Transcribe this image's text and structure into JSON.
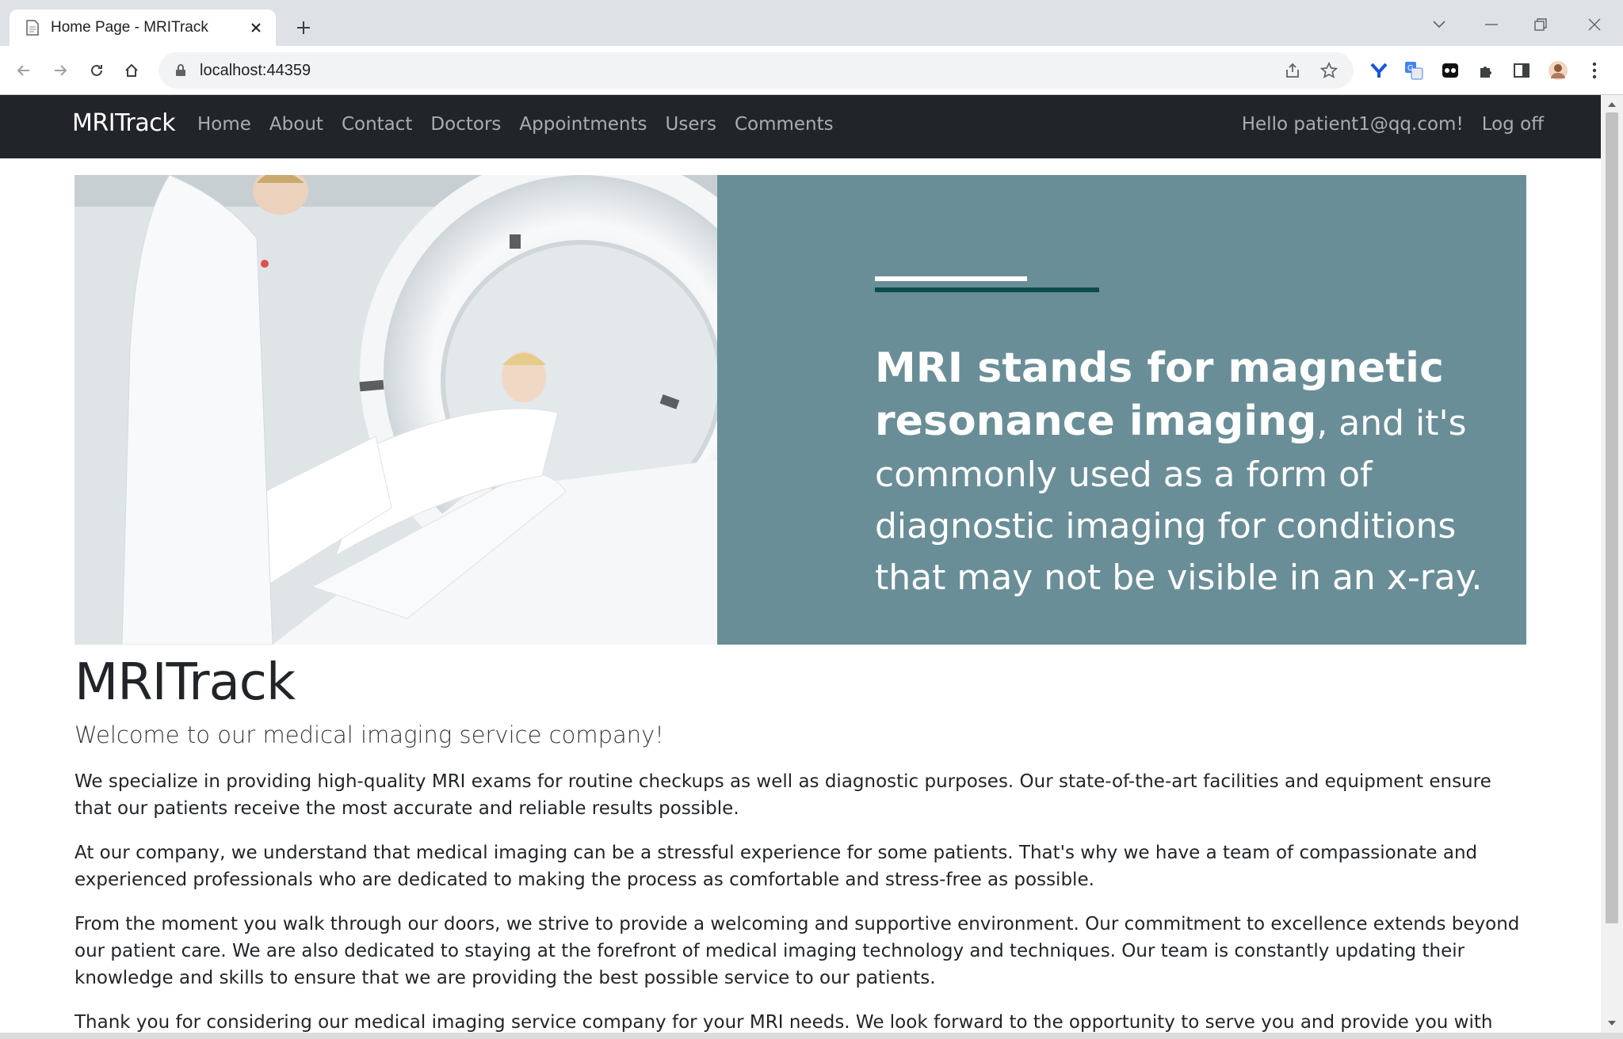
{
  "browser": {
    "tab_title": "Home Page - MRITrack",
    "url": "localhost:44359"
  },
  "navbar": {
    "brand": "MRITrack",
    "links": [
      "Home",
      "About",
      "Contact",
      "Doctors",
      "Appointments",
      "Users",
      "Comments"
    ],
    "greeting": "Hello patient1@qq.com!",
    "logoff": "Log off"
  },
  "hero": {
    "bold_text": "MRI stands for magnetic resonance imaging",
    "rest_text": ", and it's commonly used as a form of diagnostic imaging for conditions that may not be visible in an x-ray.",
    "colors": {
      "panel": "#6a8e97",
      "accent": "#0d4a52"
    }
  },
  "main": {
    "title": "MRITrack",
    "lead": "Welcome to our medical imaging service company!",
    "paragraphs": [
      "We specialize in providing high-quality MRI exams for routine checkups as well as diagnostic purposes. Our state-of-the-art facilities and equipment ensure that our patients receive the most accurate and reliable results possible.",
      "At our company, we understand that medical imaging can be a stressful experience for some patients. That's why we have a team of compassionate and experienced professionals who are dedicated to making the process as comfortable and stress-free as possible.",
      "From the moment you walk through our doors, we strive to provide a welcoming and supportive environment. Our commitment to excellence extends beyond our patient care. We are also dedicated to staying at the forefront of medical imaging technology and techniques. Our team is constantly updating their knowledge and skills to ensure that we are providing the best possible service to our patients.",
      "Thank you for considering our medical imaging service company for your MRI needs. We look forward to the opportunity to serve you and provide you with the highest"
    ]
  }
}
